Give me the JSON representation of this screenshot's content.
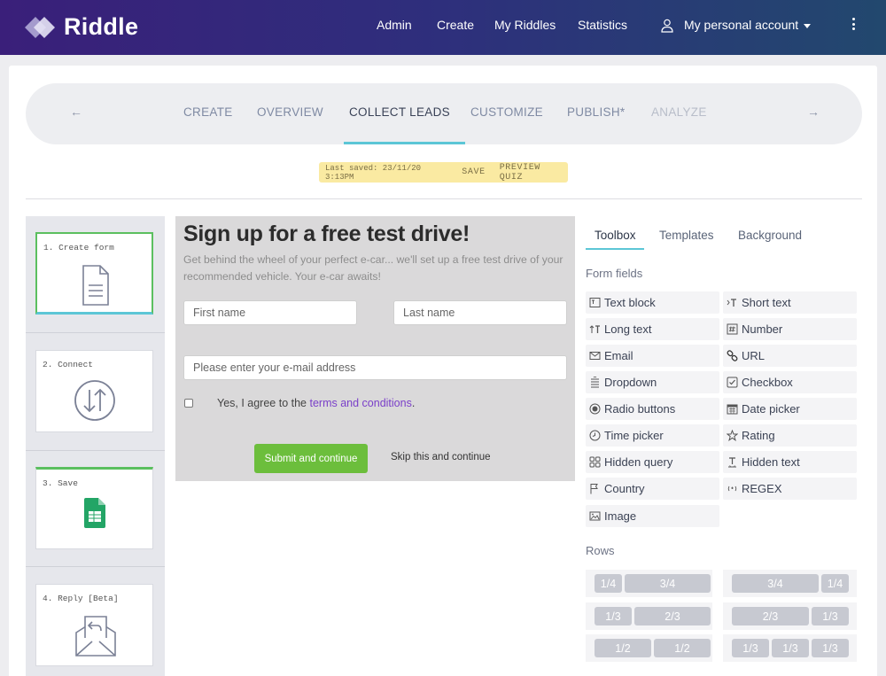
{
  "app": {
    "name": "Riddle"
  },
  "topnav": {
    "admin": "Admin",
    "create": "Create",
    "my_riddles": "My Riddles",
    "statistics": "Statistics",
    "account": "My personal account"
  },
  "steps": {
    "prev": "←",
    "next": "→",
    "items": [
      "CREATE",
      "OVERVIEW",
      "COLLECT LEADS",
      "CUSTOMIZE",
      "PUBLISH*",
      "ANALYZE"
    ]
  },
  "savebar": {
    "status": "Last saved: 23/11/20 3:13PM",
    "save": "SAVE",
    "preview": "PREVIEW QUIZ"
  },
  "sidebar": {
    "cards": [
      "1. Create form",
      "2. Connect",
      "3. Save",
      "4. Reply [Beta]"
    ]
  },
  "form": {
    "title": "Sign up for a free test drive!",
    "description": "Get behind the wheel of your perfect e-car... we'll set up a free test drive of your recommended vehicle. Your e-car awaits!",
    "first_name": "First name",
    "last_name": "Last name",
    "email": "Please enter your e-mail address",
    "agree_prefix": "Yes, I agree to the ",
    "agree_link": "terms and conditions",
    "agree_suffix": ".",
    "submit": "Submit and continue",
    "skip": "Skip this and continue"
  },
  "toolbox": {
    "tabs": [
      "Toolbox",
      "Templates",
      "Background"
    ],
    "form_fields_title": "Form fields",
    "fields": [
      "Text block",
      "Short text",
      "Long text",
      "Number",
      "Email",
      "URL",
      "Dropdown",
      "Checkbox",
      "Radio buttons",
      "Date picker",
      "Time picker",
      "Rating",
      "Hidden query",
      "Hidden text",
      "Country",
      "REGEX",
      "Image"
    ],
    "rows_title": "Rows",
    "rows": {
      "r1a": [
        "1/4",
        "3/4"
      ],
      "r1b": [
        "3/4",
        "1/4"
      ],
      "r2a": [
        "1/3",
        "2/3"
      ],
      "r2b": [
        "2/3",
        "1/3"
      ],
      "r3a": [
        "1/2",
        "1/2"
      ],
      "r3b": [
        "1/3",
        "1/3",
        "1/3"
      ]
    }
  },
  "colors": {
    "accent": "#5cc6d6",
    "submit": "#6cbe3c",
    "link": "#7a3fc9"
  }
}
